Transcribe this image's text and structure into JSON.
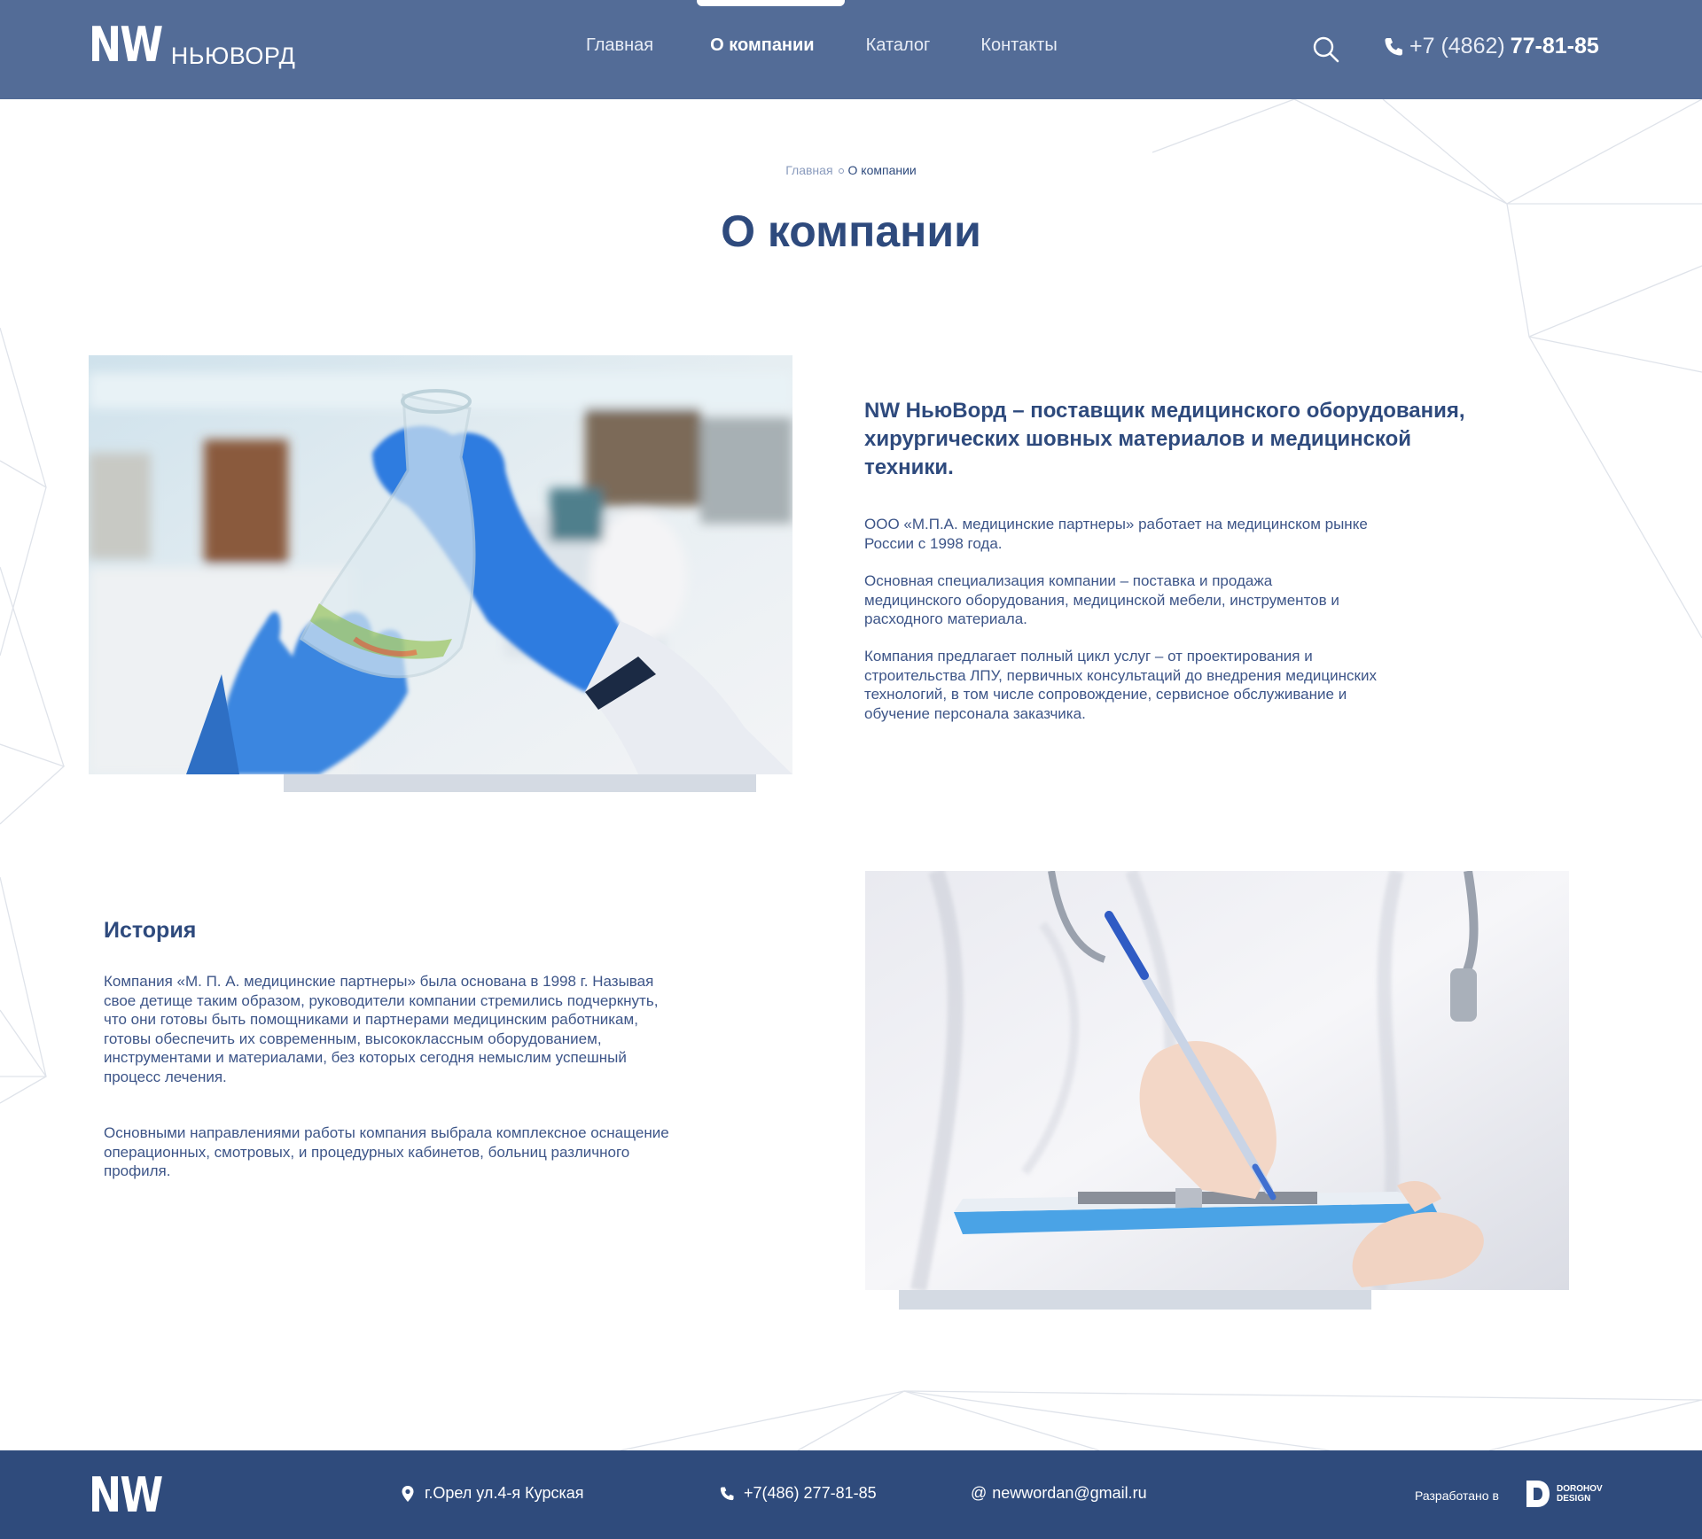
{
  "header": {
    "logo_mark": "NW",
    "logo_text": "НЬЮВОРД",
    "nav": [
      {
        "label": "Главная",
        "active": false
      },
      {
        "label": "О компании",
        "active": true
      },
      {
        "label": "Каталог",
        "active": false
      },
      {
        "label": "Контакты",
        "active": false
      }
    ],
    "phone_prefix": "+7 (4862)",
    "phone_main": "77-81-85"
  },
  "breadcrumb": {
    "home": "Главная",
    "current": "О компании"
  },
  "page_title": "О компании",
  "intro": {
    "heading": "NW НьюВорд – поставщик медицинского оборудования, хирургических шовных материалов и медицинской техники.",
    "paragraphs": [
      "ООО «М.П.А. медицинские партнеры» работает на медицинском рынке России с 1998 года.",
      "Основная специализация компании – поставка и продажа медицинского оборудования, медицинской мебели, инструментов и расходного материала.",
      "Компания предлагает полный цикл услуг – от проектирования и строительства ЛПУ, первичных консультаций до внедрения медицинских технологий, в том числе сопровождение, сервисное обслуживание и обучение персонала заказчика."
    ]
  },
  "history": {
    "title": "История",
    "paragraphs": [
      "Компания «М. П. А. медицинские партнеры» была основана в 1998 г. Называя свое детище таким образом, руководители компании стремились подчеркнуть, что они готовы быть помощниками и партнерами медицинским работникам, готовы обеспечить их современным, высококлассным оборудованием, инструментами и материалами, без которых сегодня немыслим успешный процесс лечения.",
      "Основными направлениями работы компания выбрала комплексное оснащение операционных, смотровых, и процедурных кабинетов, больниц различного профиля."
    ]
  },
  "footer": {
    "logo_mark": "NW",
    "address": "г.Орел ул.4-я Курская",
    "phone": "+7(486)  277-81-85",
    "email": "newwordan@gmail.ru",
    "developed_label": "Разработано в",
    "developer_line1": "DOROHOV",
    "developer_line2": "DESIGN"
  },
  "colors": {
    "header_bg": "#536c97",
    "footer_bg": "#2f4b7c",
    "text_primary": "#2e4a7d",
    "photo_shadow": "#d4dae3"
  },
  "icons": {
    "search": "search-icon",
    "phone": "phone-icon",
    "location": "location-pin-icon",
    "email": "at-sign-icon"
  }
}
